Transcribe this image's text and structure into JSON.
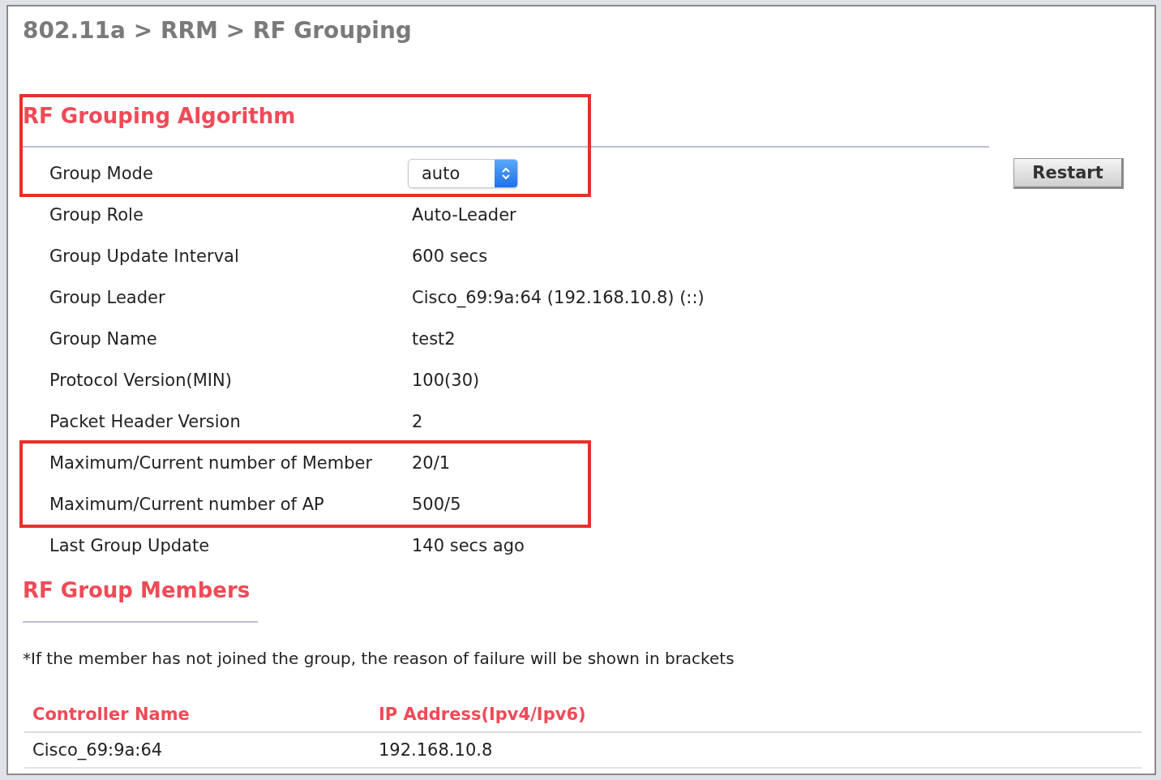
{
  "breadcrumb": "802.11a > RRM > RF Grouping",
  "algorithm": {
    "heading": "RF Grouping Algorithm",
    "highlighted": true,
    "rows": [
      {
        "kind": "select",
        "label": "Group Mode",
        "value": "auto",
        "highlighted": true
      },
      {
        "kind": "text",
        "label": "Group Role",
        "value": "Auto-Leader",
        "highlighted": false
      },
      {
        "kind": "text",
        "label": "Group Update Interval",
        "value": "600 secs",
        "highlighted": false
      },
      {
        "kind": "text",
        "label": "Group Leader",
        "value": "Cisco_69:9a:64 (192.168.10.8) (::)",
        "highlighted": false
      },
      {
        "kind": "text",
        "label": "Group Name",
        "value": "test2",
        "highlighted": false
      },
      {
        "kind": "text",
        "label": "Protocol Version(MIN)",
        "value": "100(30)",
        "highlighted": false
      },
      {
        "kind": "text",
        "label": "Packet Header Version",
        "value": "2",
        "highlighted": false
      },
      {
        "kind": "text",
        "label": "Maximum/Current number of Member",
        "value": "20/1",
        "highlighted": true
      },
      {
        "kind": "text",
        "label": "Maximum/Current number of AP",
        "value": "500/5",
        "highlighted": true
      },
      {
        "kind": "text",
        "label": "Last Group Update",
        "value": "140 secs ago",
        "highlighted": false
      }
    ],
    "button": "Restart"
  },
  "members": {
    "heading": "RF Group Members",
    "note": "*If the member has not joined the group, the reason of failure will be shown in brackets",
    "columns": [
      "Controller Name",
      "IP Address(Ipv4/Ipv6)"
    ],
    "rows": [
      [
        "Cisco_69:9a:64",
        "192.168.10.8"
      ]
    ]
  }
}
